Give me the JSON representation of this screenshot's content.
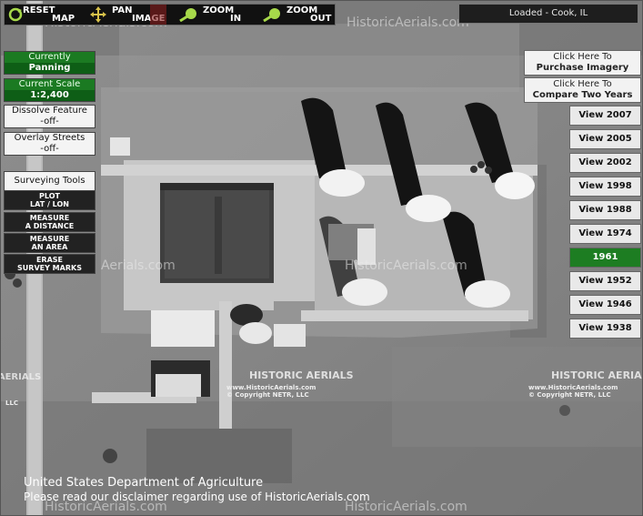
{
  "toolbar": {
    "reset": {
      "top": "RESET",
      "bottom": "MAP"
    },
    "pan": {
      "top": "PAN",
      "bottom": "IMAGE"
    },
    "zoom_in": {
      "top": "ZOOM",
      "bottom": "IN"
    },
    "zoom_out": {
      "top": "ZOOM",
      "bottom": "OUT"
    }
  },
  "status": {
    "loaded": "Loaded - Cook, IL"
  },
  "left_panel": {
    "currently_label": "Currently",
    "currently_value": "Panning",
    "scale_label": "Current Scale",
    "scale_value": "1:2,400",
    "dissolve_label": "Dissolve Feature",
    "dissolve_value": "-off-",
    "overlay_label": "Overlay Streets",
    "overlay_value": "-off-",
    "surveying_tools": "Surveying Tools",
    "tools": [
      {
        "line1": "PLOT",
        "line2": "LAT / LON"
      },
      {
        "line1": "MEASURE",
        "line2": "A DISTANCE"
      },
      {
        "line1": "MEASURE",
        "line2": "AN AREA"
      },
      {
        "line1": "ERASE",
        "line2": "SURVEY MARKS"
      }
    ]
  },
  "right_panel": {
    "purchase": {
      "line1": "Click Here To",
      "line2": "Purchase Imagery"
    },
    "compare": {
      "line1": "Click Here To",
      "line2": "Compare Two Years"
    },
    "years": [
      "View 2007",
      "View 2005",
      "View 2002",
      "View 1998",
      "View 1988",
      "View 1974",
      "1961",
      "View 1952",
      "View 1946",
      "View 1938"
    ],
    "selected_year": "1961"
  },
  "watermarks": {
    "site": "HistoricAerials.com",
    "site_partial": "Aerials.com",
    "logo_text": "HISTORIC AERIALS",
    "logo_url": "www.HistoricAerials.com",
    "logo_copyright": "© Copyright NETR, LLC",
    "llc": "LLC"
  },
  "footer": {
    "agency": "United States Department of Agriculture",
    "disclaimer": "Please read our disclaimer regarding use of HistoricAerials.com"
  },
  "colors": {
    "selected_year_bg": "#1d7d22",
    "panel_green": "#1b7a22",
    "toolbar_bg": "#111111"
  }
}
